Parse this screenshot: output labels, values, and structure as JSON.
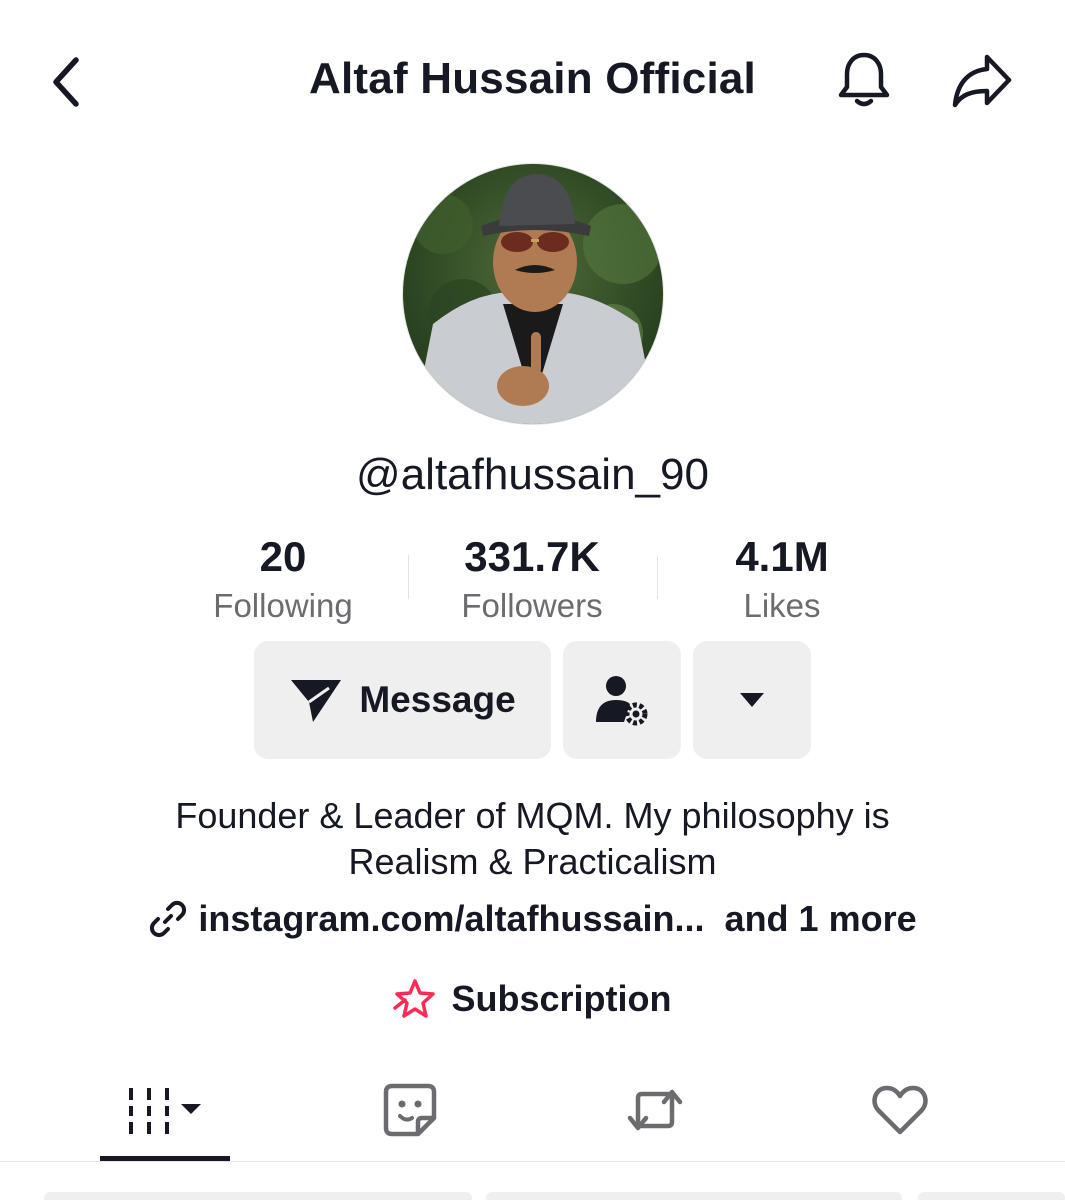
{
  "header": {
    "title": "Altaf Hussain Official"
  },
  "profile": {
    "username": "@altafhussain_90",
    "stats": [
      {
        "value": "20",
        "label": "Following"
      },
      {
        "value": "331.7K",
        "label": "Followers"
      },
      {
        "value": "4.1M",
        "label": "Likes"
      }
    ],
    "bio": "Founder & Leader of MQM.  My philosophy is\nRealism & Practicalism",
    "link_text": "instagram.com/altafhussain...",
    "more_links": "and 1 more",
    "subscription": "Subscription"
  },
  "actions": {
    "message_label": "Message"
  },
  "icons": {
    "back": "chevron-left-icon",
    "bell": "bell-icon",
    "share": "share-arrow-icon",
    "message": "paper-plane-icon",
    "friend_settings": "user-gear-icon",
    "more": "caret-down-icon",
    "link": "link-icon",
    "subscription": "star-icon",
    "tab_videos": "grid-icon",
    "tab_stickers": "sticker-face-icon",
    "tab_reposts": "repost-icon",
    "tab_liked": "heart-icon"
  },
  "colors": {
    "text": "#161823",
    "secondary": "#6b6b70",
    "button_bg": "#efefef",
    "subscription_accent": "#fe2c55"
  }
}
